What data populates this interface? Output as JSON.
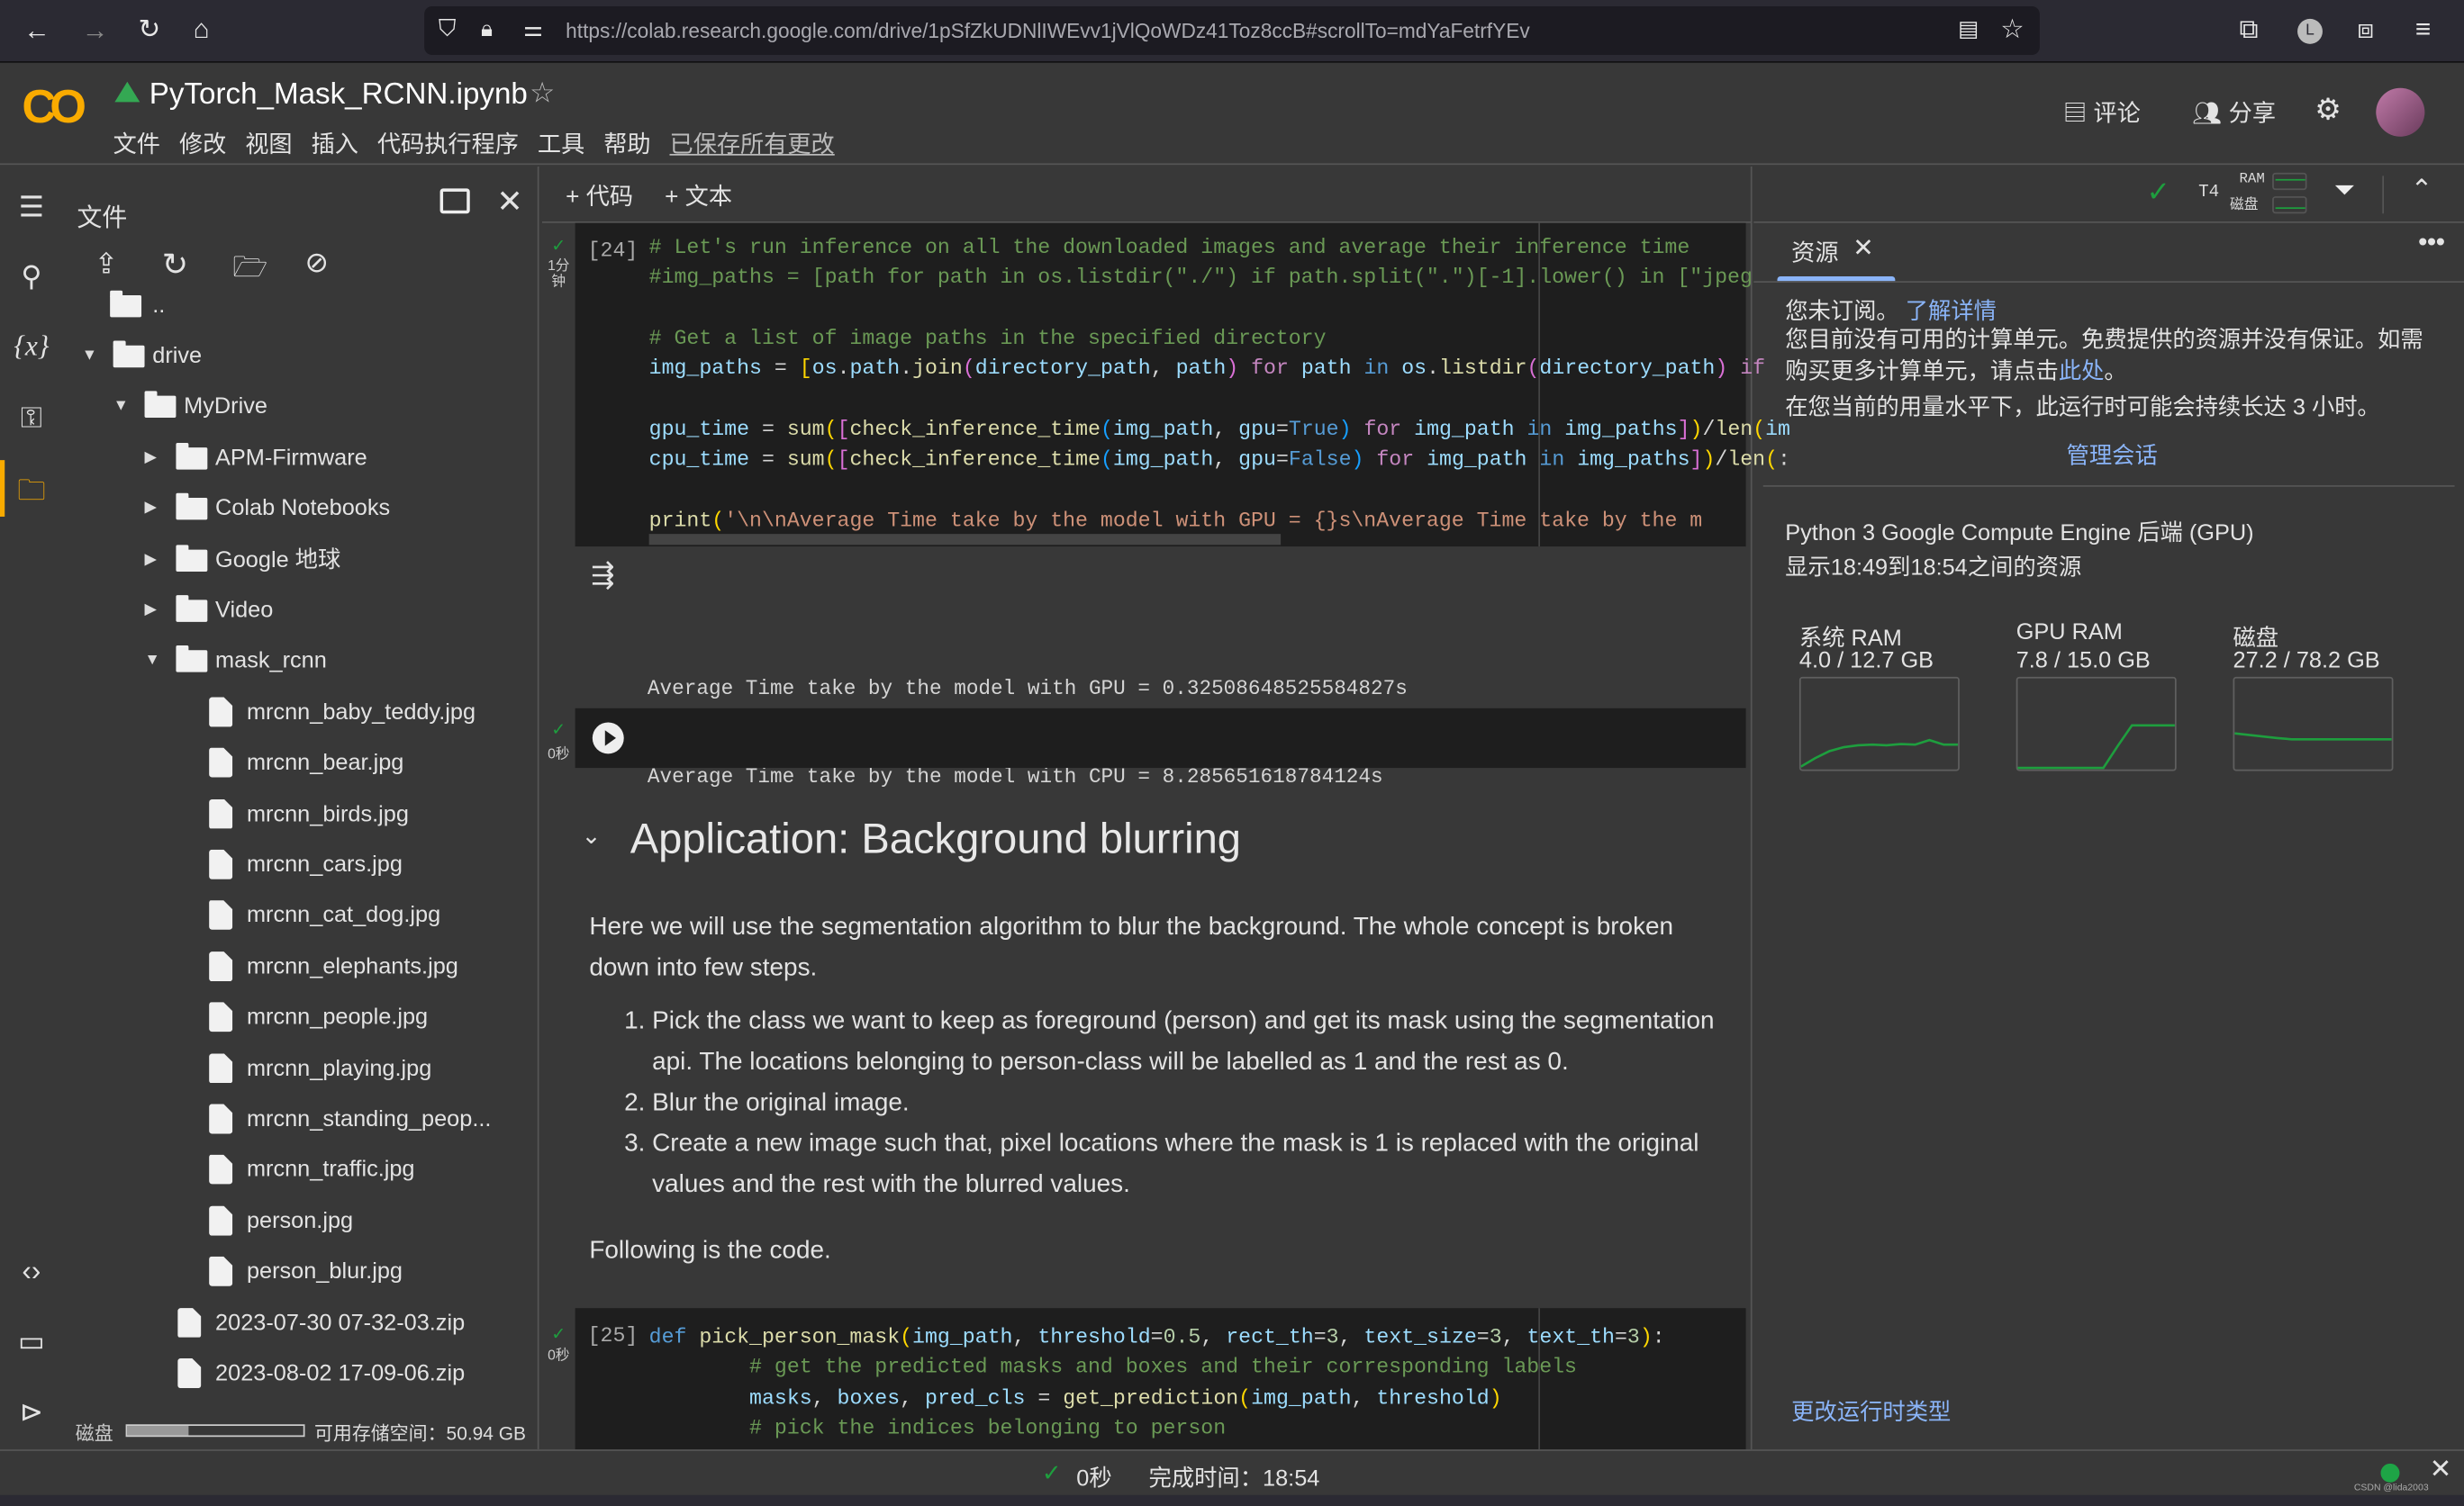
{
  "browser": {
    "url": "https://colab.research.google.com/drive/1pSfZkUDNlIWEvv1jVlQoWDz41Toz8ccB#scrollTo=mdYaFetrfYEv",
    "icons": [
      "back-icon",
      "forward-icon",
      "reload-icon",
      "home-icon",
      "shield-icon",
      "lock-icon",
      "permissions-icon",
      "reader-icon",
      "bookmark-star-icon",
      "extension-icon",
      "profile-icon",
      "puzzle-icon",
      "menu-icon"
    ]
  },
  "header": {
    "logo": "CO",
    "title": "PyTorch_Mask_RCNN.ipynb",
    "menu": [
      "文件",
      "修改",
      "视图",
      "插入",
      "代码执行程序",
      "工具",
      "帮助"
    ],
    "saved": "已保存所有更改",
    "comment": "评论",
    "share": "分享"
  },
  "files": {
    "title": "文件",
    "disk_label": "磁盘",
    "disk_used_fraction": 0.35,
    "disk_free": "可用存储空间：50.94 GB",
    "tree": [
      {
        "name": "..",
        "type": "folder-open",
        "level": 0
      },
      {
        "name": "drive",
        "type": "folder",
        "level": 0,
        "expanded": true
      },
      {
        "name": "MyDrive",
        "type": "folder",
        "level": 1,
        "expanded": true
      },
      {
        "name": "APM-Firmware",
        "type": "folder",
        "level": 2,
        "expanded": false
      },
      {
        "name": "Colab Notebooks",
        "type": "folder",
        "level": 2,
        "expanded": false
      },
      {
        "name": "Google 地球",
        "type": "folder",
        "level": 2,
        "expanded": false
      },
      {
        "name": "Video",
        "type": "folder",
        "level": 2,
        "expanded": false
      },
      {
        "name": "mask_rcnn",
        "type": "folder",
        "level": 2,
        "expanded": true
      },
      {
        "name": "mrcnn_baby_teddy.jpg",
        "type": "file",
        "level": 3
      },
      {
        "name": "mrcnn_bear.jpg",
        "type": "file",
        "level": 3
      },
      {
        "name": "mrcnn_birds.jpg",
        "type": "file",
        "level": 3
      },
      {
        "name": "mrcnn_cars.jpg",
        "type": "file",
        "level": 3
      },
      {
        "name": "mrcnn_cat_dog.jpg",
        "type": "file",
        "level": 3
      },
      {
        "name": "mrcnn_elephants.jpg",
        "type": "file",
        "level": 3
      },
      {
        "name": "mrcnn_people.jpg",
        "type": "file",
        "level": 3
      },
      {
        "name": "mrcnn_playing.jpg",
        "type": "file",
        "level": 3
      },
      {
        "name": "mrcnn_standing_peop...",
        "type": "file",
        "level": 3
      },
      {
        "name": "mrcnn_traffic.jpg",
        "type": "file",
        "level": 3
      },
      {
        "name": "person.jpg",
        "type": "file",
        "level": 3
      },
      {
        "name": "person_blur.jpg",
        "type": "file",
        "level": 3
      },
      {
        "name": "2023-07-30 07-32-03.zip",
        "type": "file",
        "level": 2
      },
      {
        "name": "2023-08-02 17-09-06.zip",
        "type": "file",
        "level": 2
      }
    ]
  },
  "toolbar": {
    "add_code": "+ 代码",
    "add_text": "+ 文本",
    "runtime": "T4",
    "ram": "RAM",
    "disk": "磁盘"
  },
  "cells": {
    "c24": {
      "label": "[24]",
      "time": "1分钟",
      "lines": [
        [
          [
            "c",
            "# Let's run inference on all the downloaded images and average their inference time"
          ]
        ],
        [
          [
            "c",
            "#img_paths = [path for path in os.listdir(\"./\") if path.split(\".\")[-1].lower() in [\"jpeg"
          ]
        ],
        [],
        [
          [
            "c",
            "# Get a list of image paths in the specified directory"
          ]
        ],
        [
          [
            "v",
            "img_paths"
          ],
          [
            "p",
            " = "
          ],
          [
            "y",
            "["
          ],
          [
            "v",
            "os"
          ],
          [
            "p",
            "."
          ],
          [
            "v",
            "path"
          ],
          [
            "p",
            "."
          ],
          [
            "f",
            "join"
          ],
          [
            "m",
            "("
          ],
          [
            "v",
            "directory_path"
          ],
          [
            "p",
            ", "
          ],
          [
            "v",
            "path"
          ],
          [
            "m",
            ")"
          ],
          [
            "k",
            " for "
          ],
          [
            "v",
            "path"
          ],
          [
            "b",
            " in "
          ],
          [
            "v",
            "os"
          ],
          [
            "p",
            "."
          ],
          [
            "f",
            "listdir"
          ],
          [
            "m",
            "("
          ],
          [
            "v",
            "directory_path"
          ],
          [
            "m",
            ")"
          ],
          [
            "k",
            " if"
          ]
        ],
        [],
        [
          [
            "v",
            "gpu_time"
          ],
          [
            "p",
            " = "
          ],
          [
            "f",
            "sum"
          ],
          [
            "y",
            "("
          ],
          [
            "m",
            "["
          ],
          [
            "f",
            "check_inference_time"
          ],
          [
            "l",
            "("
          ],
          [
            "v",
            "img_path"
          ],
          [
            "p",
            ", "
          ],
          [
            "v",
            "gpu"
          ],
          [
            "p",
            "="
          ],
          [
            "b",
            "True"
          ],
          [
            "l",
            ")"
          ],
          [
            "k",
            " for "
          ],
          [
            "v",
            "img_path"
          ],
          [
            "b",
            " in "
          ],
          [
            "v",
            "img_paths"
          ],
          [
            "m",
            "]"
          ],
          [
            "y",
            ")"
          ],
          [
            "p",
            "/"
          ],
          [
            "f",
            "len"
          ],
          [
            "y",
            "("
          ],
          [
            "v",
            "im"
          ]
        ],
        [
          [
            "v",
            "cpu_time"
          ],
          [
            "p",
            " = "
          ],
          [
            "f",
            "sum"
          ],
          [
            "y",
            "("
          ],
          [
            "m",
            "["
          ],
          [
            "f",
            "check_inference_time"
          ],
          [
            "l",
            "("
          ],
          [
            "v",
            "img_path"
          ],
          [
            "p",
            ", "
          ],
          [
            "v",
            "gpu"
          ],
          [
            "p",
            "="
          ],
          [
            "b",
            "False"
          ],
          [
            "l",
            ")"
          ],
          [
            "k",
            " for "
          ],
          [
            "v",
            "img_path"
          ],
          [
            "b",
            " in "
          ],
          [
            "v",
            "img_paths"
          ],
          [
            "m",
            "]"
          ],
          [
            "y",
            ")"
          ],
          [
            "p",
            "/"
          ],
          [
            "f",
            "len"
          ],
          [
            "y",
            "("
          ],
          [
            "p",
            ":"
          ]
        ],
        [],
        [
          [
            "f",
            "print"
          ],
          [
            "y",
            "("
          ],
          [
            "s",
            "'\\n\\nAverage Time take by the model with GPU = {}s\\nAverage Time take by the m"
          ]
        ]
      ],
      "output": [
        "Average Time take by the model with GPU = 0.32508648525584827s",
        "Average Time take by the model with CPU = 8.285651618784124s"
      ]
    },
    "empty": {
      "time": "0秒"
    },
    "markdown": {
      "heading": "Application: Background blurring",
      "para": "Here we will use the segmentation algorithm to blur the background. The whole concept is broken down into few steps.",
      "items": [
        "Pick the class we want to keep as foreground (person) and get its mask using the segmentation api. The locations belonging to person-class will be labelled as 1 and the rest as 0.",
        "Blur the original image.",
        "Create a new image such that, pixel locations where the mask is 1 is replaced with the original values and the rest with the blurred values."
      ],
      "after": "Following is the code."
    },
    "c25": {
      "label": "[25]",
      "time": "0秒",
      "lines": [
        [
          [
            "b",
            "def "
          ],
          [
            "f",
            "pick_person_mask"
          ],
          [
            "y",
            "("
          ],
          [
            "v",
            "img_path"
          ],
          [
            "p",
            ", "
          ],
          [
            "v",
            "threshold"
          ],
          [
            "p",
            "="
          ],
          [
            "n",
            "0.5"
          ],
          [
            "p",
            ", "
          ],
          [
            "v",
            "rect_th"
          ],
          [
            "p",
            "="
          ],
          [
            "n",
            "3"
          ],
          [
            "p",
            ", "
          ],
          [
            "v",
            "text_size"
          ],
          [
            "p",
            "="
          ],
          [
            "n",
            "3"
          ],
          [
            "p",
            ", "
          ],
          [
            "v",
            "text_th"
          ],
          [
            "p",
            "="
          ],
          [
            "n",
            "3"
          ],
          [
            "y",
            ")"
          ],
          [
            "p",
            ":"
          ]
        ],
        [
          [
            "p",
            "        "
          ],
          [
            "c",
            "# get the predicted masks and boxes and their corresponding labels"
          ]
        ],
        [
          [
            "p",
            "        "
          ],
          [
            "v",
            "masks"
          ],
          [
            "p",
            ", "
          ],
          [
            "v",
            "boxes"
          ],
          [
            "p",
            ", "
          ],
          [
            "v",
            "pred_cls"
          ],
          [
            "p",
            " = "
          ],
          [
            "f",
            "get_prediction"
          ],
          [
            "y",
            "("
          ],
          [
            "v",
            "img_path"
          ],
          [
            "p",
            ", "
          ],
          [
            "v",
            "threshold"
          ],
          [
            "y",
            ")"
          ]
        ],
        [
          [
            "p",
            "        "
          ],
          [
            "c",
            "# pick the indices belonging to person"
          ]
        ]
      ]
    }
  },
  "resources": {
    "tab": "资源",
    "not_subscribed": "您未订阅。",
    "learn_more": "了解详情",
    "units_text": "您目前没有可用的计算单元。免费提供的资源并没有保证。如需购买更多计算单元，请点击",
    "here": "此处",
    "period": "。",
    "duration": "在您当前的用量水平下，此运行时可能会持续长达 3 小时。",
    "manage": "管理会话",
    "backend": "Python 3 Google Compute Engine 后端 (GPU)",
    "range": "显示18:49到18:54之间的资源",
    "gauges": [
      {
        "name": "系统 RAM",
        "value": "4.0 / 12.7 GB",
        "total": 12.7,
        "history": [
          0.2,
          1.5,
          2.6,
          3.2,
          3.5,
          3.6,
          3.5,
          3.7,
          3.6,
          4.3,
          3.6,
          3.6
        ]
      },
      {
        "name": "GPU RAM",
        "value": "7.8 / 15.0 GB",
        "total": 15.0,
        "history": [
          0,
          0,
          0,
          0,
          0,
          0,
          0,
          4,
          7.8,
          7.8,
          7.8,
          7.8
        ]
      },
      {
        "name": "磁盘",
        "value": "27.2 / 78.2 GB",
        "total": 78.2,
        "history": [
          33,
          31.5,
          30,
          28.5,
          27.2,
          27.2,
          27.2,
          27.2,
          27.2,
          27.2,
          27.2,
          27.2
        ]
      }
    ],
    "change_runtime": "更改运行时类型"
  },
  "status": {
    "time": "0秒",
    "done": "完成时间：18:54",
    "watermark": "CSDN @lida2003"
  },
  "colors": {
    "accent": "#f9ab00",
    "link": "#8ab4f8",
    "ok": "#1e9e3e",
    "graph": "#1e9e3e"
  }
}
